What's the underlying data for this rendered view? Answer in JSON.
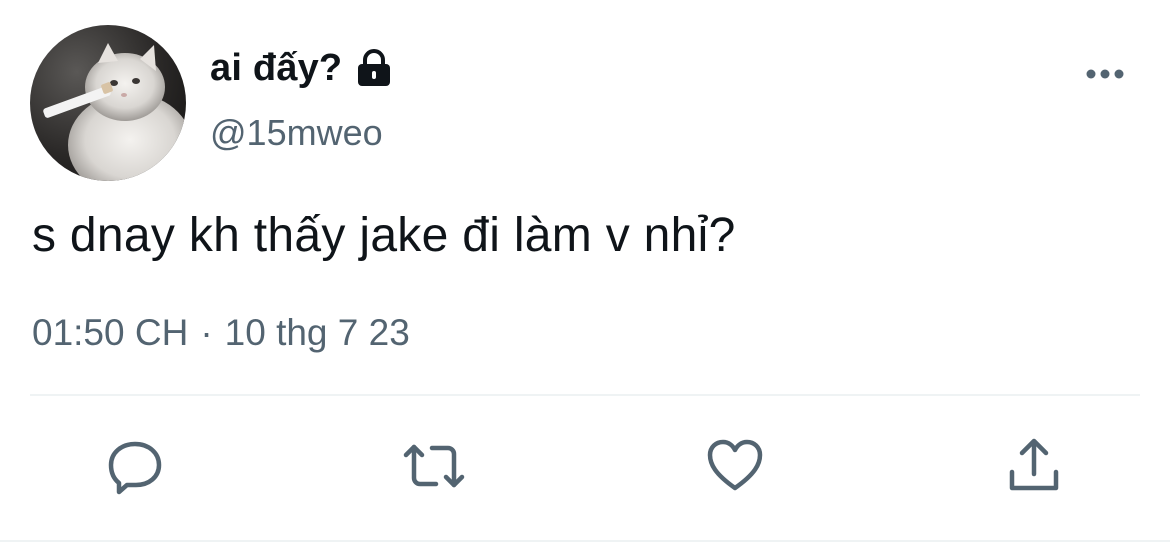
{
  "author": {
    "display_name": "ai đấy?",
    "handle": "@15mweo",
    "protected_icon": "lock-icon",
    "avatar": "avatar"
  },
  "tweet": {
    "text": "s dnay kh thấy jake đi làm v nhỉ?",
    "time": "01:50 CH",
    "separator": "·",
    "date": "10 thg 7 23"
  },
  "menu_icon": "more-icon",
  "actions": [
    {
      "name": "reply",
      "icon": "reply-icon"
    },
    {
      "name": "retweet",
      "icon": "retweet-icon"
    },
    {
      "name": "like",
      "icon": "heart-icon"
    },
    {
      "name": "share",
      "icon": "share-icon"
    }
  ],
  "colors": {
    "primary_text": "#0f1419",
    "secondary_text": "#536471",
    "divider": "#eff3f4"
  }
}
